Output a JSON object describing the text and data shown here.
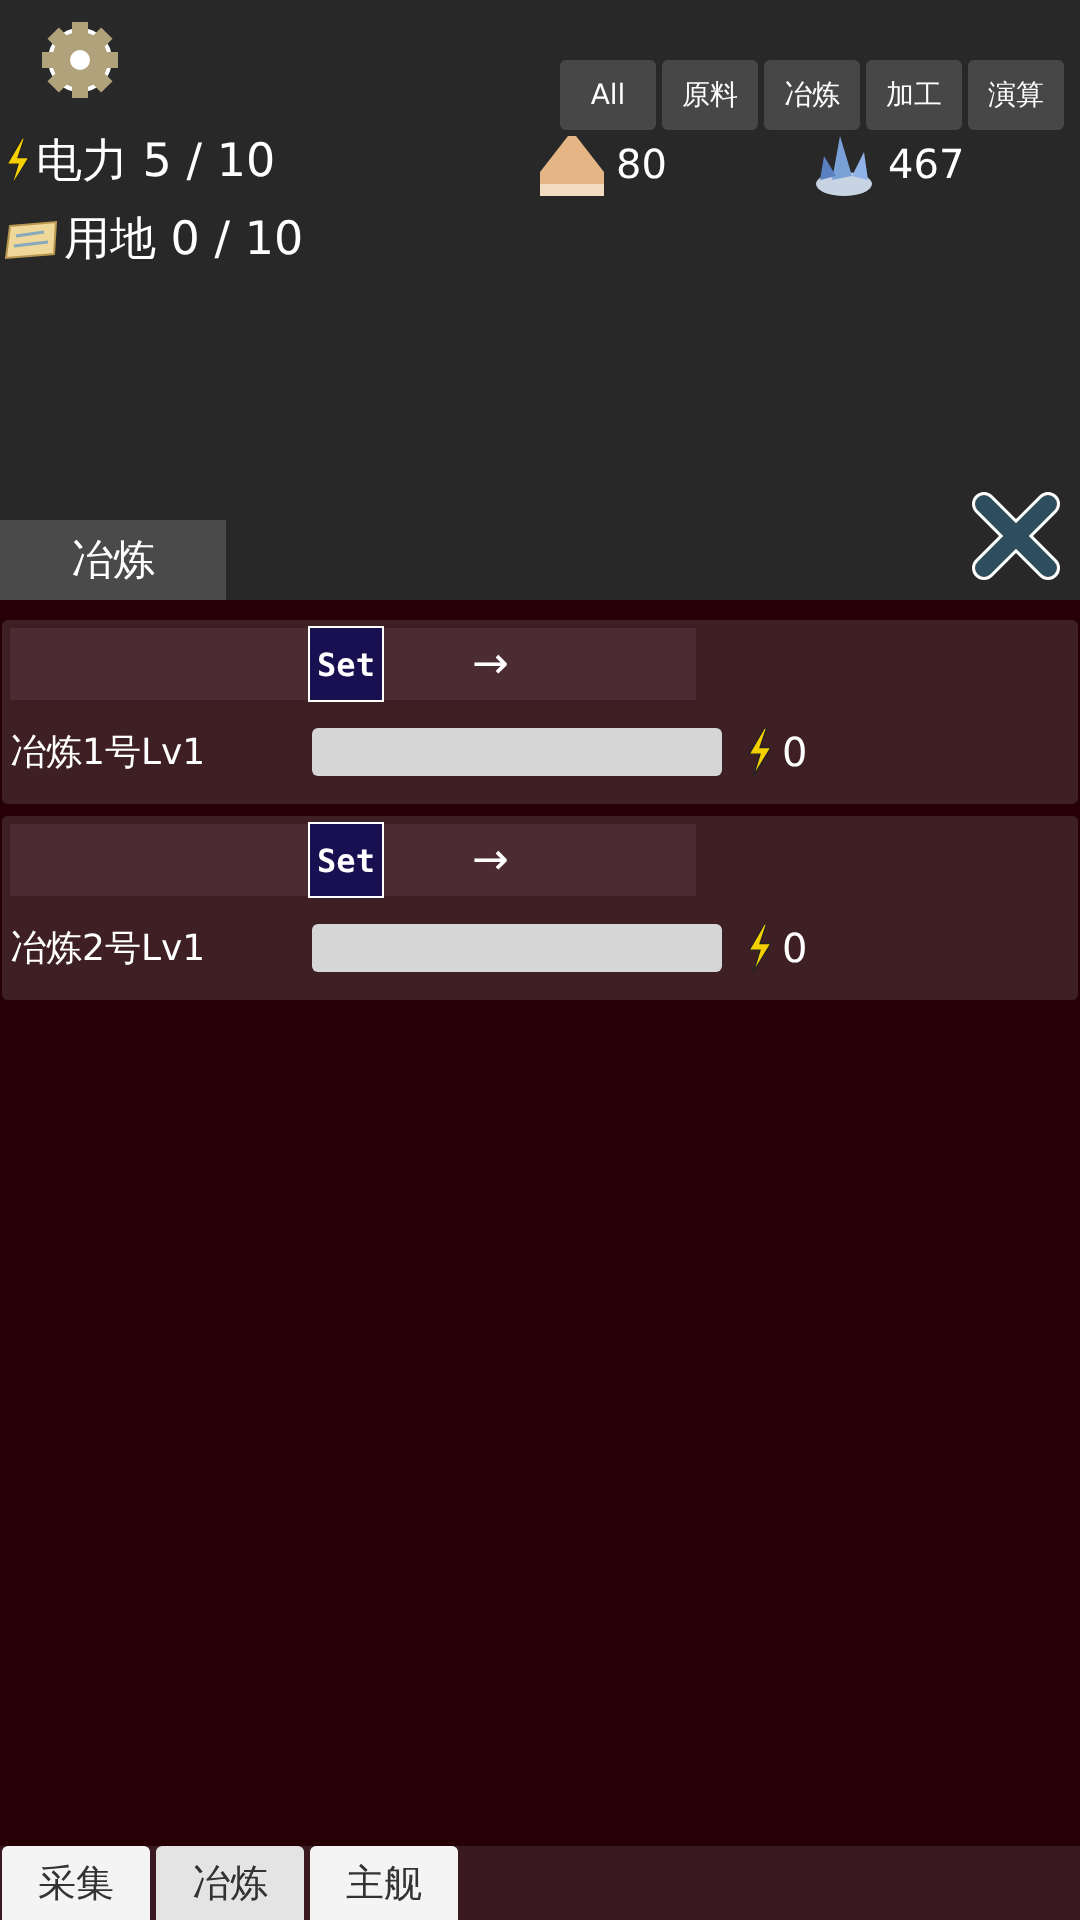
{
  "filters": [
    "All",
    "原料",
    "冶炼",
    "加工",
    "演算"
  ],
  "stats": [
    {
      "kind": "power",
      "text": "电力 5 / 10"
    },
    {
      "kind": "land",
      "text": "用地 0 / 10"
    }
  ],
  "resources": [
    {
      "kind": "sand",
      "amount": "80"
    },
    {
      "kind": "crystal",
      "amount": "467"
    }
  ],
  "panel": {
    "title": "冶炼",
    "machines": [
      {
        "set": "Set",
        "arrow": "→",
        "name": "冶炼1号Lv1",
        "level": 0,
        "power": "0"
      },
      {
        "set": "Set",
        "arrow": "→",
        "name": "冶炼2号Lv1",
        "level": 0,
        "power": "0"
      }
    ]
  },
  "nav": [
    {
      "label": "采集",
      "selected": false
    },
    {
      "label": "冶炼",
      "selected": true
    },
    {
      "label": "主舰",
      "selected": false
    }
  ]
}
